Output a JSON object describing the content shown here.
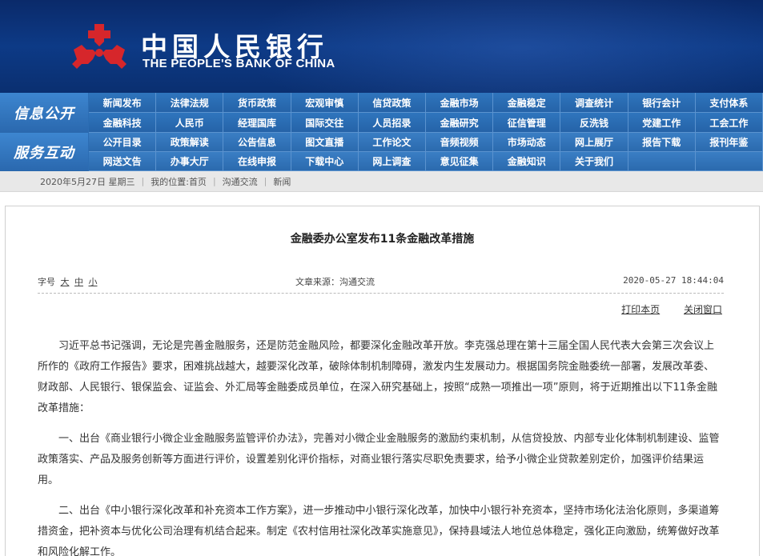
{
  "header": {
    "name_cn": "中国人民银行",
    "name_en": "THE PEOPLE'S BANK OF CHINA"
  },
  "nav": {
    "info_label": "信息公开",
    "service_label": "服务互动",
    "info_items": [
      "新闻发布",
      "法律法规",
      "货币政策",
      "宏观审慎",
      "信贷政策",
      "金融市场",
      "金融稳定",
      "调查统计",
      "银行会计",
      "支付体系",
      "金融科技",
      "人民币",
      "经理国库",
      "国际交往",
      "人员招录",
      "金融研究",
      "征信管理",
      "反洗钱",
      "党建工作",
      "工会工作"
    ],
    "service_items": [
      "公开目录",
      "政策解读",
      "公告信息",
      "图文直播",
      "工作论文",
      "音频视频",
      "市场动态",
      "网上展厅",
      "报告下载",
      "报刊年鉴",
      "网送文告",
      "办事大厅",
      "在线申报",
      "下载中心",
      "网上调查",
      "意见征集",
      "金融知识",
      "关于我们"
    ]
  },
  "breadcrumb": {
    "date": "2020年5月27日",
    "weekday": "星期三",
    "location_label": "我的位置:",
    "home": "首页",
    "section": "沟通交流",
    "current": "新闻"
  },
  "article": {
    "title": "金融委办公室发布11条金融改革措施",
    "font_size_label": "字号",
    "size_large": "大",
    "size_medium": "中",
    "size_small": "小",
    "source": "文章来源：沟通交流",
    "datetime": "2020-05-27 18:44:04",
    "print_label": "打印本页",
    "close_label": "关闭窗口",
    "paragraphs": [
      "习近平总书记强调，无论是完善金融服务，还是防范金融风险，都要深化金融改革开放。李克强总理在第十三届全国人民代表大会第三次会议上所作的《政府工作报告》要求，困难挑战越大，越要深化改革，破除体制机制障碍，激发内生发展动力。根据国务院金融委统一部署，发展改革委、财政部、人民银行、银保监会、证监会、外汇局等金融委成员单位，在深入研究基础上，按照“成熟一项推出一项”原则，将于近期推出以下11条金融改革措施：",
      "一、出台《商业银行小微企业金融服务监管评价办法》，完善对小微企业金融服务的激励约束机制，从信贷投放、内部专业化体制机制建设、监管政策落实、产品及服务创新等方面进行评价，设置差别化评价指标，对商业银行落实尽职免责要求，给予小微企业贷款差别定价，加强评价结果运用。",
      "二、出台《中小银行深化改革和补充资本工作方案》，进一步推动中小银行深化改革，加快中小银行补充资本，坚持市场化法治化原则，多渠道筹措资金，把补资本与优化公司治理有机结合起来。制定《农村信用社深化改革实施意见》，保持县域法人地位总体稳定，强化正向激励，统筹做好改革和风险化解工作。"
    ]
  },
  "colors": {
    "banner_dark": "#0a2a6a",
    "nav_blue": "#2c6db4",
    "logo_red": "#d6262b"
  }
}
